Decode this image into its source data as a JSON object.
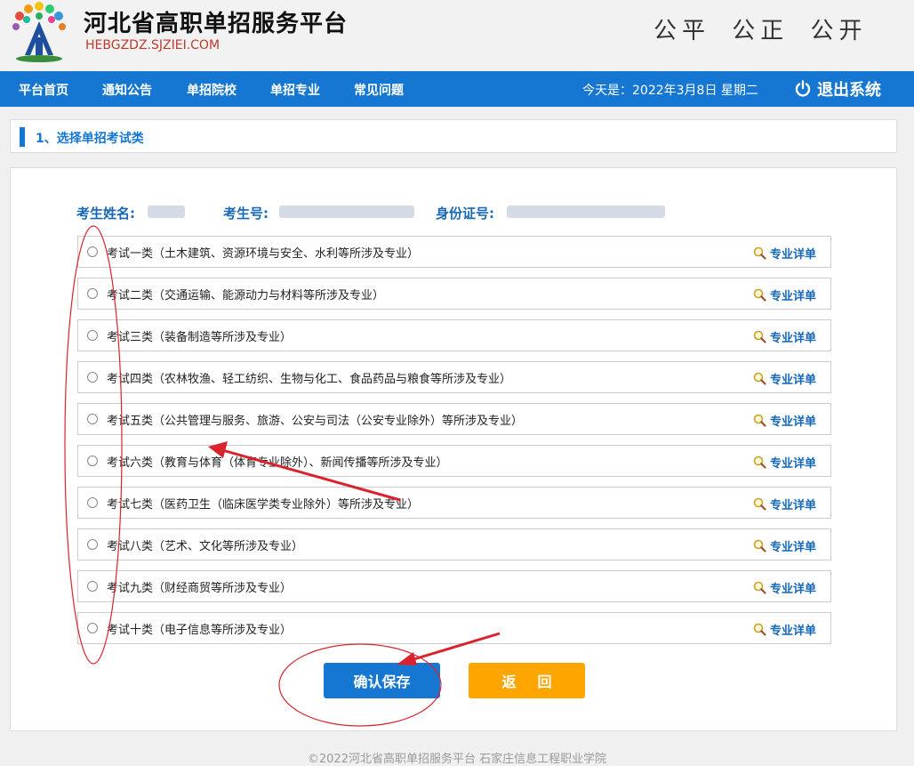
{
  "header": {
    "title": "河北省高职单招服务平台",
    "domain": "HEBGZDZ.SJZIEI.COM",
    "slogan": "公平 公正 公开"
  },
  "nav": {
    "items": [
      "平台首页",
      "通知公告",
      "单招院校",
      "单招专业",
      "常见问题"
    ],
    "date": "今天是：2022年3月8日 星期二",
    "logout": "退出系统"
  },
  "section": {
    "title": "1、选择单招考试类"
  },
  "student": {
    "name_label": "考生姓名:",
    "exam_no_label": "考生号:",
    "id_label": "身份证号:"
  },
  "options": [
    {
      "label": "考试一类（土木建筑、资源环境与安全、水利等所涉及专业）",
      "detail": "专业详单"
    },
    {
      "label": "考试二类（交通运输、能源动力与材料等所涉及专业）",
      "detail": "专业详单"
    },
    {
      "label": "考试三类（装备制造等所涉及专业）",
      "detail": "专业详单"
    },
    {
      "label": "考试四类（农林牧渔、轻工纺织、生物与化工、食品药品与粮食等所涉及专业）",
      "detail": "专业详单"
    },
    {
      "label": "考试五类（公共管理与服务、旅游、公安与司法（公安专业除外）等所涉及专业）",
      "detail": "专业详单"
    },
    {
      "label": "考试六类（教育与体育（体育专业除外）、新闻传播等所涉及专业）",
      "detail": "专业详单"
    },
    {
      "label": "考试七类（医药卫生（临床医学类专业除外）等所涉及专业）",
      "detail": "专业详单"
    },
    {
      "label": "考试八类（艺术、文化等所涉及专业）",
      "detail": "专业详单"
    },
    {
      "label": "考试九类（财经商贸等所涉及专业）",
      "detail": "专业详单"
    },
    {
      "label": "考试十类（电子信息等所涉及专业）",
      "detail": "专业详单"
    }
  ],
  "buttons": {
    "save": "确认保存",
    "back": "返回"
  },
  "footer": "©2022河北省高职单招服务平台  石家庄信息工程职业学院",
  "colors": {
    "primary": "#1677d2",
    "back_button": "#ffa500",
    "annotation": "#d9232e"
  }
}
